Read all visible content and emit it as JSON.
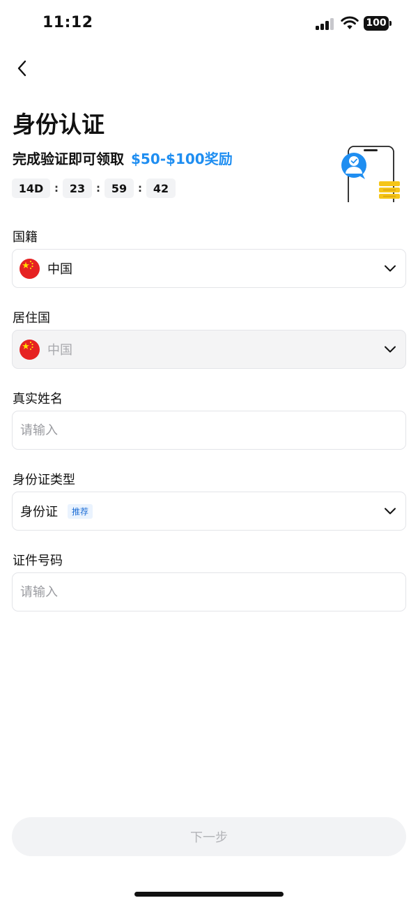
{
  "status_bar": {
    "time": "11:12",
    "battery": "100"
  },
  "header": {
    "title": "身份认证"
  },
  "reward": {
    "prefix": "完成验证即可领取",
    "amount": "$50-$100奖励"
  },
  "countdown": {
    "days": "14D",
    "hours": "23",
    "minutes": "59",
    "seconds": "42",
    "separator": ":"
  },
  "form": {
    "nationality": {
      "label": "国籍",
      "value": "中国",
      "flag": "china-flag-icon"
    },
    "residence": {
      "label": "居住国",
      "value": "中国",
      "flag": "china-flag-icon"
    },
    "real_name": {
      "label": "真实姓名",
      "placeholder": "请输入"
    },
    "id_type": {
      "label": "身份证类型",
      "value": "身份证",
      "tag": "推荐"
    },
    "id_number": {
      "label": "证件号码",
      "placeholder": "请输入"
    }
  },
  "footer": {
    "next_label": "下一步"
  },
  "colors": {
    "accent": "#1f8ef1",
    "coin": "#f5c518",
    "flag_red": "#e62222",
    "flag_star": "#ffde00"
  }
}
